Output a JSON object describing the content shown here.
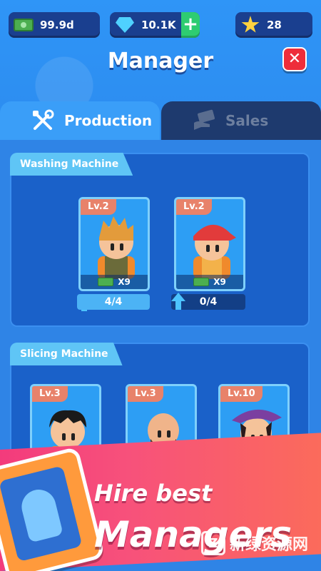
{
  "currencies": {
    "cash": "99.9d",
    "gems": "10.1K",
    "gems_plus": "+",
    "stars": "28"
  },
  "header": {
    "title": "Manager",
    "close_symbol": "✕"
  },
  "tabs": [
    {
      "label": "Production",
      "icon": "tools-icon",
      "active": true
    },
    {
      "label": "Sales",
      "icon": "sales-hand-icon",
      "active": false
    }
  ],
  "sections": [
    {
      "name": "Washing Machine",
      "managers": [
        {
          "level": "Lv.2",
          "multiplier": "X9",
          "count": "4/4"
        },
        {
          "level": "Lv.2",
          "multiplier": "X9",
          "count": "0/4"
        }
      ]
    },
    {
      "name": "Slicing Machine",
      "managers": [
        {
          "level": "Lv.3"
        },
        {
          "level": "Lv.3"
        },
        {
          "level": "Lv.10"
        }
      ]
    }
  ],
  "promo": {
    "line1": "Hire best",
    "line2": "Managers"
  },
  "watermark": {
    "text": "新绿资源网",
    "logo": "Z"
  },
  "colors": {
    "background": "#2a8cf0",
    "banner": "#f33b7c",
    "close": "#ee2d3a",
    "plus": "#2ecc71"
  }
}
